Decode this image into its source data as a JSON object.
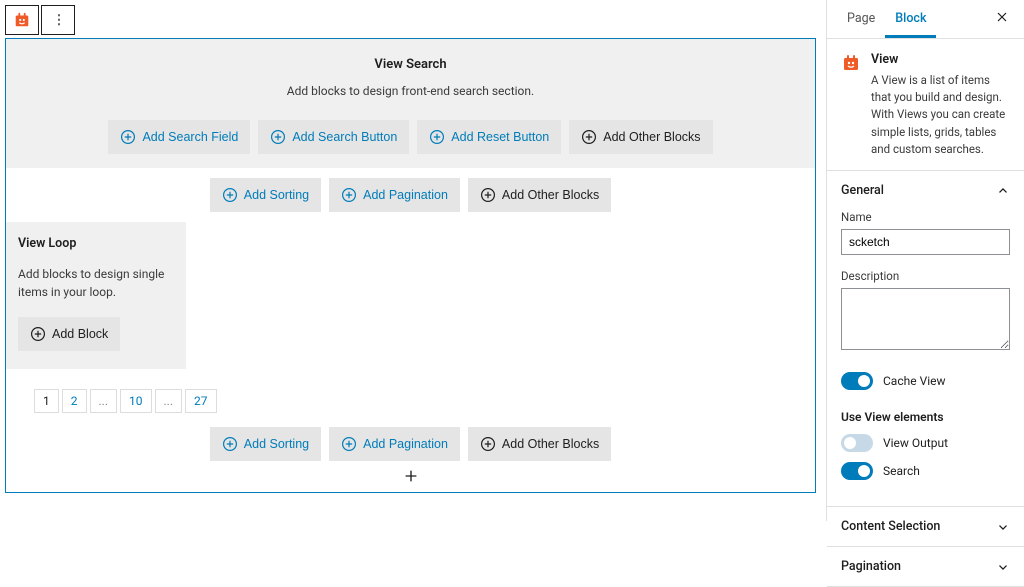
{
  "toolbar": {
    "view_icon": "toolset-view-icon",
    "menu_icon": "⋮"
  },
  "view_search": {
    "title": "View Search",
    "subtitle": "Add blocks to design front-end search section.",
    "buttons": {
      "search_field": "Add Search Field",
      "search_button": "Add Search Button",
      "reset_button": "Add Reset Button",
      "other": "Add Other Blocks"
    }
  },
  "sort_row": {
    "sorting": "Add Sorting",
    "pagination": "Add Pagination",
    "other": "Add Other Blocks"
  },
  "view_loop": {
    "title": "View Loop",
    "subtitle": "Add blocks to design single items in your loop.",
    "add_block": "Add Block"
  },
  "pagination": {
    "pages": [
      "1",
      "2",
      "...",
      "10",
      "...",
      "27"
    ]
  },
  "sidebar": {
    "tabs": {
      "page": "Page",
      "block": "Block"
    },
    "block_info": {
      "name": "View",
      "desc": "A View is a list of items that you build and design. With Views you can create simple lists, grids, tables and custom searches."
    },
    "general": {
      "title": "General",
      "name_label": "Name",
      "name_value": "scketch",
      "desc_label": "Description",
      "desc_value": "",
      "cache_label": "Cache View",
      "cache_on": true,
      "elements_head": "Use View elements",
      "output_label": "View Output",
      "output_on": false,
      "search_label": "Search",
      "search_on": true
    },
    "content_sel": "Content Selection",
    "pagin": "Pagination"
  }
}
